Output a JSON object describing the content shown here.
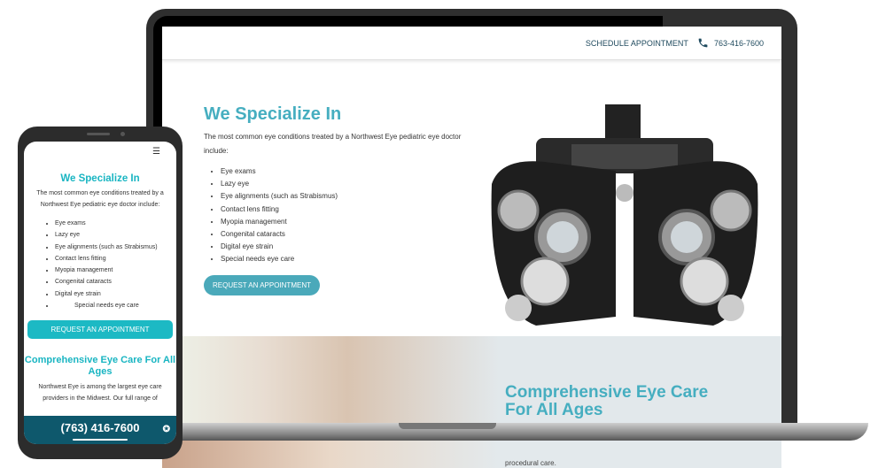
{
  "header": {
    "schedule": "SCHEDULE APPOINTMENT",
    "phone": "763-416-7600"
  },
  "specialize": {
    "title": "We Specialize In",
    "intro": "The most common eye conditions treated by a Northwest Eye pediatric eye doctor include:",
    "items": [
      "Eye exams",
      "Lazy eye",
      "Eye alignments (such as Strabismus)",
      "Contact lens fitting",
      "Myopia management",
      "Congenital cataracts",
      "Digital eye strain",
      "Special needs eye care"
    ],
    "button": "REQUEST AN APPOINTMENT"
  },
  "comprehensive": {
    "title": "Comprehensive Eye Care For All Ages",
    "text": "Northwest Eye is among the largest eye care providers in the Midwest. Our full range of",
    "tail": "procedural care."
  },
  "mobile": {
    "phone_bar": "(763) 416-7600"
  },
  "colors": {
    "accent": "#46aec0",
    "mobile_accent": "#19b5c2",
    "phone_bar": "#0e586c"
  }
}
